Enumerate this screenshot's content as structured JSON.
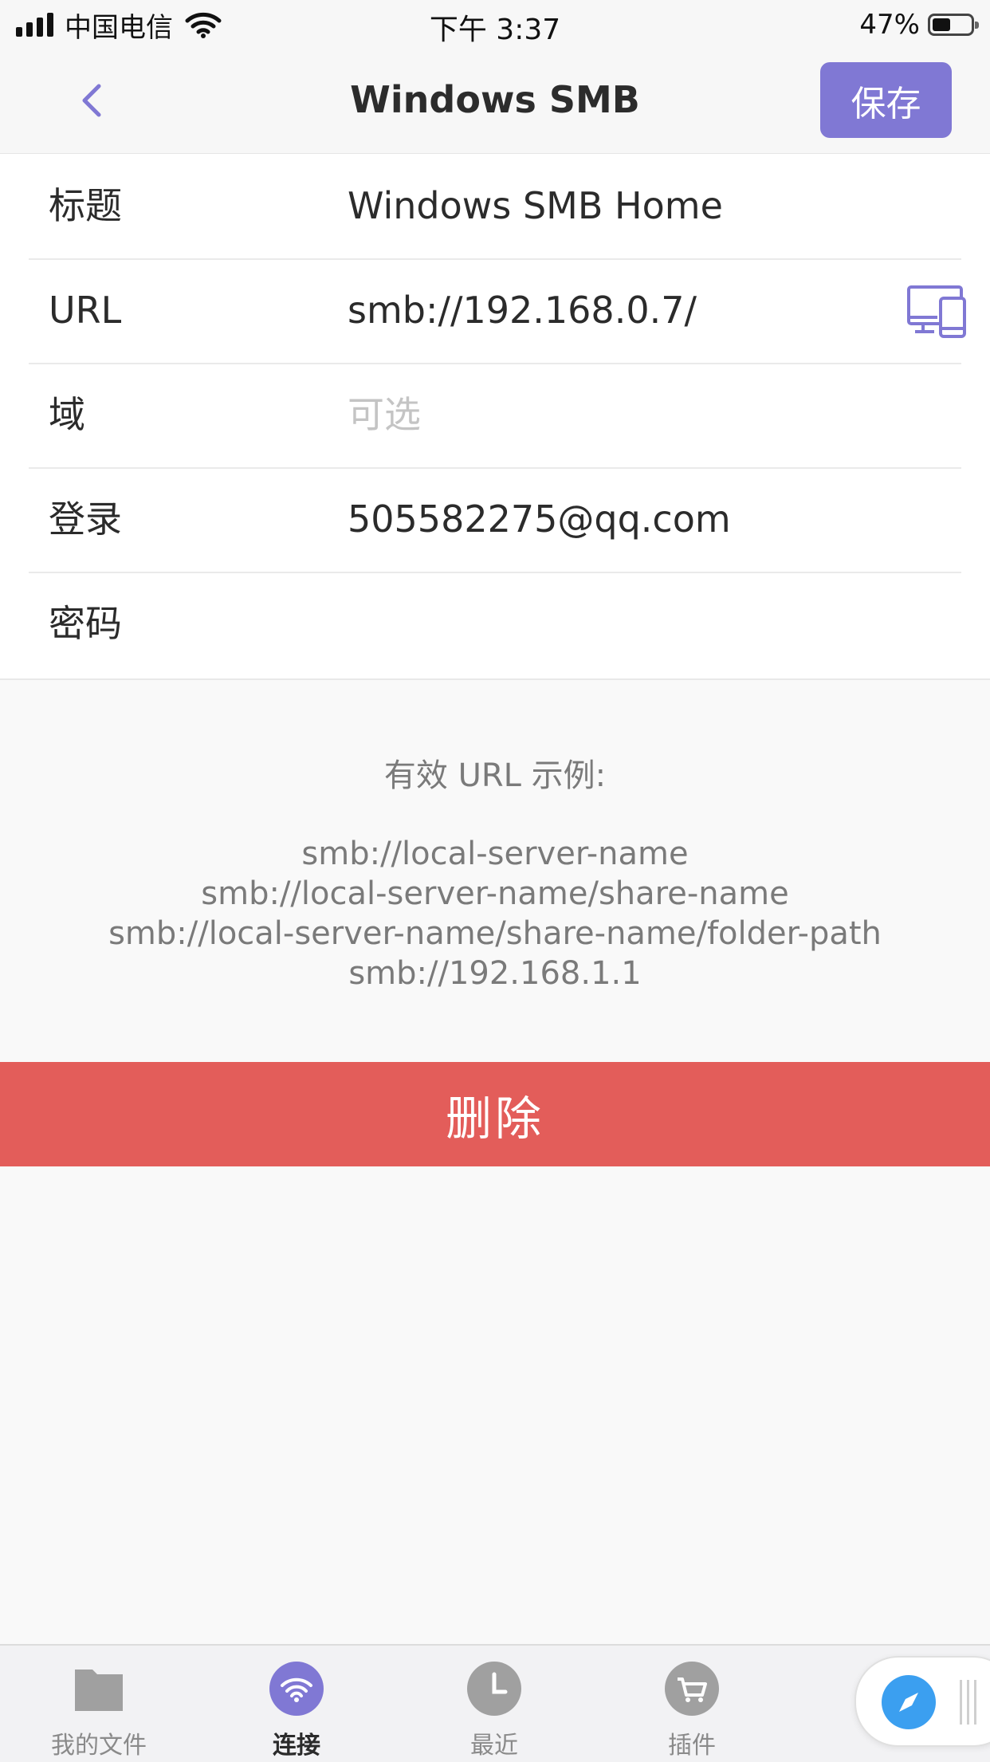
{
  "status_bar": {
    "carrier": "中国电信",
    "time": "下午 3:37",
    "battery_pct": "47%",
    "battery_level": 0.47
  },
  "nav": {
    "back_icon": "chevron-left-icon",
    "title": "Windows SMB",
    "save_label": "保存"
  },
  "form": {
    "title_label": "标题",
    "title_value": "Windows SMB Home",
    "url_label": "URL",
    "url_value": "smb://192.168.0.7/",
    "url_icon": "devices-icon",
    "domain_label": "域",
    "domain_value": "",
    "domain_placeholder": "可选",
    "login_label": "登录",
    "login_value": "505582275@qq.com",
    "password_label": "密码",
    "password_value": ""
  },
  "examples": {
    "heading": "有效 URL 示例:",
    "lines": [
      "smb://local-server-name",
      "smb://local-server-name/share-name",
      "smb://local-server-name/share-name/folder-path",
      "smb://192.168.1.1"
    ]
  },
  "delete_label": "删除",
  "tabs": [
    {
      "label": "我的文件",
      "icon": "folder-icon",
      "active": false
    },
    {
      "label": "连接",
      "icon": "wifi-icon",
      "active": true
    },
    {
      "label": "最近",
      "icon": "clock-icon",
      "active": false
    },
    {
      "label": "插件",
      "icon": "cart-icon",
      "active": false
    }
  ],
  "floating_control": {
    "icon": "compass-icon"
  },
  "colors": {
    "accent": "#8078d4",
    "delete": "#e35d5a",
    "browser_blue": "#3b9ff0"
  }
}
